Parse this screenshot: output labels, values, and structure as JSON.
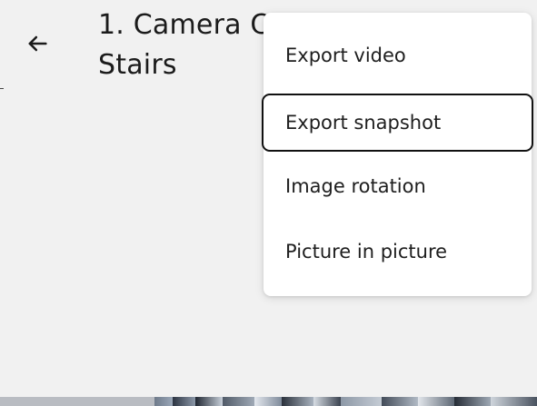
{
  "header": {
    "back_icon": "arrow-left-icon",
    "title_line1": "1. Camera C",
    "title_line2": "Stairs"
  },
  "menu": {
    "items": [
      {
        "label": "Export video"
      },
      {
        "label": "Export snapshot",
        "focused": true
      },
      {
        "label": "Image rotation"
      },
      {
        "label": "Picture in picture"
      }
    ]
  },
  "colors": {
    "background": "#f1f1f1",
    "menu_background": "#ffffff",
    "text": "#1b1b1b",
    "focus_outline": "#111111"
  }
}
